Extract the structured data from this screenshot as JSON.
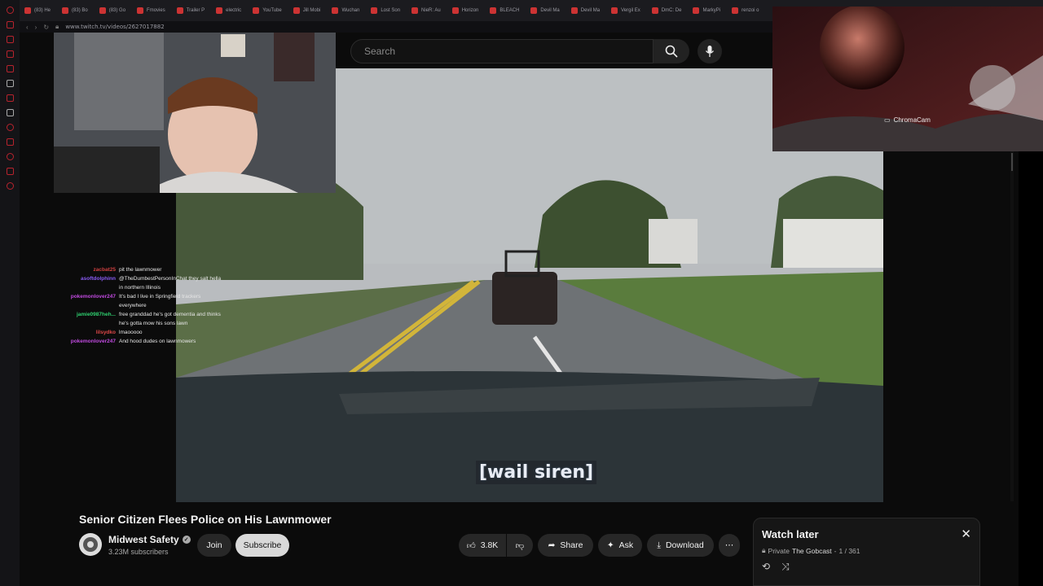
{
  "browser": {
    "tabs": [
      "(83) He",
      "(83) Bo",
      "(83) Go",
      "Fmovies",
      "Trailer P",
      "electric",
      "YouTube",
      "Jill Mobi",
      "Wuchan",
      "Lost Son",
      "NieR: Au",
      "Horizon",
      "BLEACH",
      "Devil Ma",
      "Devil Ma",
      "Vergil Ex",
      "DmC: De",
      "MarkyPi",
      "renzoi o"
    ],
    "url": "www.twitch.tv/videos/2627017882"
  },
  "search": {
    "placeholder": "Search"
  },
  "video": {
    "caption": "[wail siren]",
    "title": "Senior Citizen Flees Police on His Lawnmower"
  },
  "channel": {
    "name": "Midwest Safety",
    "subscribers": "3.23M subscribers",
    "join_label": "Join",
    "subscribe_label": "Subscribe"
  },
  "actions": {
    "likes": "3.8K",
    "share": "Share",
    "ask": "Ask",
    "download": "Download"
  },
  "watch_later": {
    "title": "Watch later",
    "privacy": "Private",
    "owner": "The Gobcast",
    "position": "1 / 361"
  },
  "chromacam": {
    "label": "ChromaCam"
  },
  "chat": [
    {
      "user": "zacbat25",
      "text": "pit the lawnmower",
      "color": "#d04040"
    },
    {
      "user": "asoftdolphinn",
      "text": "@TheDumbestPersonInChat they salt hella in northern Illinois",
      "color": "#8a5cf6"
    },
    {
      "user": "pokemonlover247",
      "text": "It's bad I live in Springfield trackers everywhere",
      "color": "#c04adf"
    },
    {
      "user": "jamie0987heh...",
      "text": "free granddad he's got dementia and thinks he's gotta mow his sons lawn",
      "color": "#2fcf6f"
    },
    {
      "user": "lilsydko",
      "text": "lmaooooo",
      "color": "#e04848"
    },
    {
      "user": "pokemonlover247",
      "text": "And hood dudes on lawnmowers",
      "color": "#c04adf"
    }
  ],
  "colors": {
    "accent": "#b8232d",
    "background": "#0b0b0b"
  }
}
